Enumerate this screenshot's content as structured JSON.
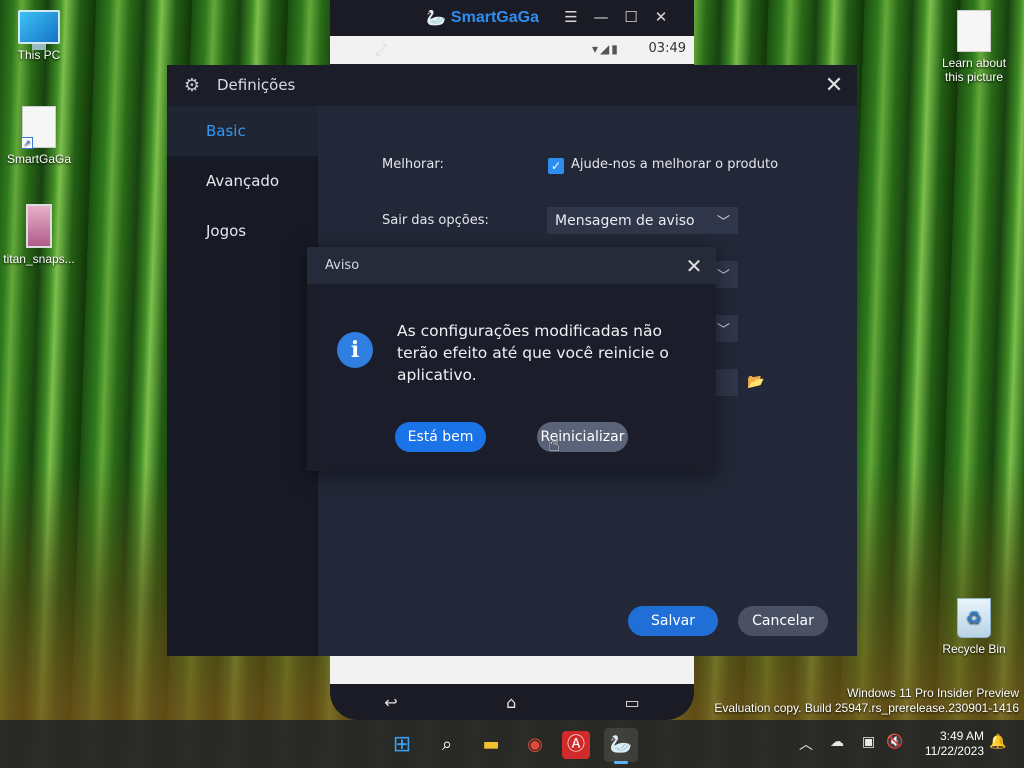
{
  "desktop": {
    "icons": [
      {
        "label": "This PC",
        "icon": "computer-icon"
      },
      {
        "label": "SmartGaGa",
        "icon": "shortcut-file-icon"
      },
      {
        "label": "titan_snaps...",
        "icon": "image-file-icon"
      },
      {
        "label": "Learn about this picture",
        "icon": "file-icon"
      },
      {
        "label": "Recycle Bin",
        "icon": "recycle-bin-icon"
      }
    ],
    "watermark_line1": "Windows 11 Pro Insider Preview",
    "watermark_line2": "Evaluation copy. Build 25947.rs_prerelease.230901-1416"
  },
  "emulator": {
    "brand": "SmartGaGa",
    "status_time": "03:49",
    "controls": [
      "menu-icon",
      "minimize-icon",
      "maximize-icon",
      "close-icon"
    ]
  },
  "settings": {
    "title": "Definições",
    "sidebar": [
      {
        "label": "Basic",
        "active": true
      },
      {
        "label": "Avançado",
        "active": false
      },
      {
        "label": "Jogos",
        "active": false
      }
    ],
    "improve_label": "Melhorar:",
    "improve_checkbox_label": "Ajude-nos a melhorar o produto",
    "improve_checked": true,
    "exit_label": "Sair das opções:",
    "exit_value": "Mensagem de aviso",
    "save_label": "Salvar",
    "cancel_label": "Cancelar"
  },
  "modal": {
    "title": "Aviso",
    "message": "As configurações modificadas não terão efeito até que você reinicie o aplicativo.",
    "ok_label": "Está bem",
    "restart_label": "Reinicializar"
  },
  "taskbar": {
    "apps": [
      "windows-start-icon",
      "search-icon",
      "file-explorer-icon",
      "chrome-icon",
      "acrobat-icon",
      "smartgaga-icon"
    ],
    "clock_time": "3:49 AM",
    "clock_date": "11/22/2023"
  },
  "colors": {
    "accent": "#2e8ef0",
    "dialog_bg": "#232838",
    "modal_bg": "#1b1e2a"
  }
}
